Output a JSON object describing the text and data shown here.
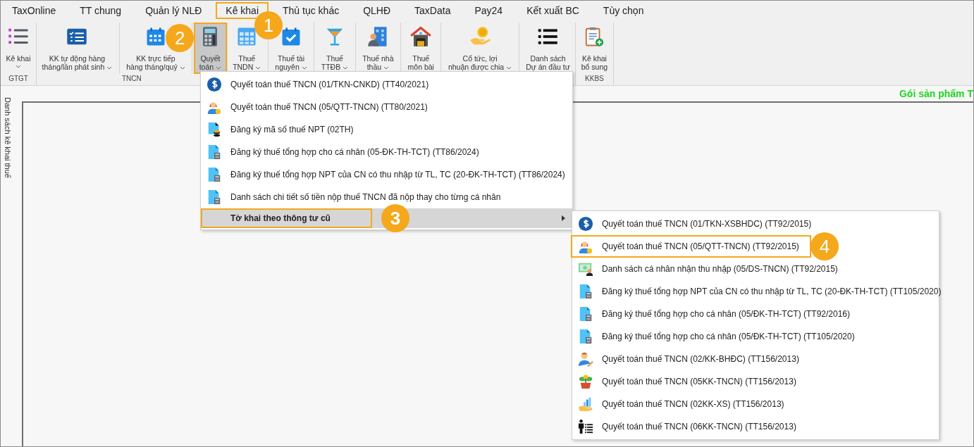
{
  "tabs": [
    {
      "label": "TaxOnline",
      "highlighted": false
    },
    {
      "label": "TT chung",
      "highlighted": false
    },
    {
      "label": "Quản lý NLĐ",
      "highlighted": false
    },
    {
      "label": "Kê khai",
      "highlighted": true,
      "callout": "1"
    },
    {
      "label": "Thủ tục khác",
      "highlighted": false
    },
    {
      "label": "QLHĐ",
      "highlighted": false
    },
    {
      "label": "TaxData",
      "highlighted": false
    },
    {
      "label": "Pay24",
      "highlighted": false
    },
    {
      "label": "Kết xuất BC",
      "highlighted": false
    },
    {
      "label": "Tùy chọn",
      "highlighted": false
    }
  ],
  "ribbon": {
    "groups": [
      {
        "label": "GTGT",
        "buttons": [
          {
            "label": "Kê khai",
            "dropdown": true,
            "selected": false,
            "highlighted": false
          }
        ]
      },
      {
        "label": "TNCN",
        "buttons": [
          {
            "label": "KK tự động hàng\ntháng/lần phát sinh",
            "dropdown": true,
            "selected": false,
            "highlighted": false
          },
          {
            "label": "KK trực tiếp\nhàng tháng/quý",
            "dropdown": true,
            "selected": false,
            "highlighted": false
          },
          {
            "label": "Quyết\ntoán",
            "dropdown": true,
            "selected": true,
            "highlighted": true,
            "callout": "2"
          }
        ]
      },
      {
        "buttons": [
          {
            "label": "Thuế\nTNDN",
            "dropdown": true,
            "selected": false,
            "highlighted": false
          },
          {
            "label": "Thuế tài\nnguyên",
            "dropdown": true,
            "selected": false,
            "highlighted": false
          },
          {
            "label": "Thuế\nTTĐB",
            "dropdown": true,
            "selected": false,
            "highlighted": false
          },
          {
            "label": "Thuế nhà\nthầu",
            "dropdown": true,
            "selected": false,
            "highlighted": false
          },
          {
            "label": "Thuế\nmôn bài",
            "dropdown": false,
            "selected": false,
            "highlighted": false
          },
          {
            "label": "Cổ tức, lợi\nnhuận được chia",
            "dropdown": true,
            "selected": false,
            "highlighted": false
          },
          {
            "label": "Danh sách\nDự án đầu tư",
            "dropdown": false,
            "selected": false,
            "highlighted": false
          }
        ]
      },
      {
        "label": "KKBS",
        "buttons": [
          {
            "label": "Kê khai\nbổ sung",
            "dropdown": false,
            "selected": false,
            "highlighted": false
          }
        ]
      }
    ]
  },
  "info_bar": {
    "text": "Gói sản phẩm T"
  },
  "side_panel": {
    "title": "Danh sách kê khai thuế"
  },
  "menu": {
    "items": [
      {
        "label": "Quyết toán thuế TNCN (01/TKN-CNKD) (TT40/2021)",
        "selected": false,
        "highlighted": false,
        "submenu": false
      },
      {
        "label": "Quyết toán thuế TNCN (05/QTT-TNCN) (TT80/2021)",
        "selected": false,
        "highlighted": false,
        "submenu": false
      },
      {
        "label": "Đăng ký mã số thuế NPT (02TH)",
        "selected": false,
        "highlighted": false,
        "submenu": false
      },
      {
        "label": "Đăng ký thuế tổng hợp cho cá nhân (05-ĐK-TH-TCT) (TT86/2024)",
        "selected": false,
        "highlighted": false,
        "submenu": false
      },
      {
        "label": "Đăng ký thuế tổng hợp NPT của CN có thu nhập từ TL, TC (20-ĐK-TH-TCT) (TT86/2024)",
        "selected": false,
        "highlighted": false,
        "submenu": false
      },
      {
        "label": "Danh sách chi tiết số tiền nộp thuế TNCN đã nộp thay cho từng cá nhân",
        "selected": false,
        "highlighted": false,
        "submenu": false
      },
      {
        "label": "Tờ khai theo thông tư cũ",
        "selected": true,
        "highlighted": true,
        "submenu": true,
        "callout": "3"
      }
    ]
  },
  "submenu": {
    "items": [
      {
        "label": "Quyết toán thuế TNCN (01/TKN-XSBHDC) (TT92/2015)",
        "highlighted": false
      },
      {
        "label": "Quyết toán thuế TNCN (05/QTT-TNCN) (TT92/2015)",
        "highlighted": true,
        "callout": "4"
      },
      {
        "label": "Danh sách cá nhân nhận thu nhập (05/DS-TNCN) (TT92/2015)",
        "highlighted": false
      },
      {
        "label": "Đăng ký thuế tổng hợp NPT của CN có thu nhập từ TL, TC (20-ĐK-TH-TCT) (TT105/2020)",
        "highlighted": false
      },
      {
        "label": "Đăng ký thuế tổng hợp cho cá nhân (05/ĐK-TH-TCT) (TT92/2016)",
        "highlighted": false
      },
      {
        "label": "Đăng ký thuế tổng hợp cho cá nhân (05/ĐK-TH-TCT) (TT105/2020)",
        "highlighted": false
      },
      {
        "label": "Quyết toán thuế TNCN (02/KK-BHĐC) (TT156/2013)",
        "highlighted": false
      },
      {
        "label": "Quyết toán thuế TNCN (05KK-TNCN) (TT156/2013)",
        "highlighted": false
      },
      {
        "label": "Quyết toán thuế TNCN (02KK-XS) (TT156/2013)",
        "highlighted": false
      },
      {
        "label": "Quyết toán thuế TNCN (06KK-TNCN) (TT156/2013)",
        "highlighted": false
      }
    ]
  }
}
